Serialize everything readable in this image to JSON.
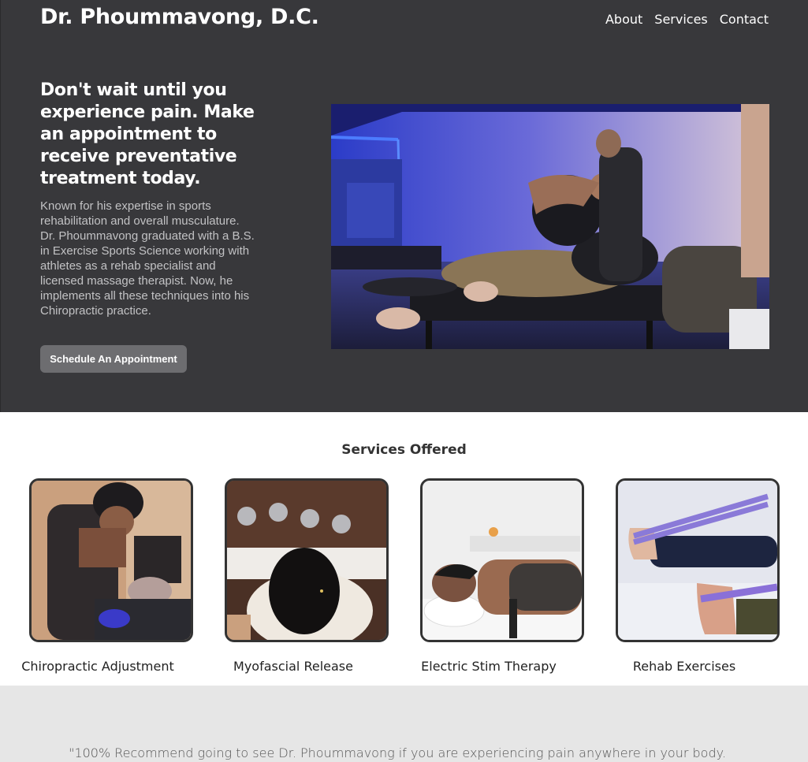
{
  "header": {
    "brand": "Dr. Phoummavong, D.C.",
    "nav": [
      "About",
      "Services",
      "Contact"
    ]
  },
  "hero": {
    "headline": "Don't wait until you experience pain. Make an appointment to receive preventative treatment today.",
    "bio": "Known for his expertise in sports rehabilitation and overall musculature. Dr. Phoummavong graduated with a B.S. in Exercise Sports Science working with athletes as a rehab specialist and licensed massage therapist. Now, he implements all these techniques into his Chiropractic practice.",
    "cta_label": "Schedule An Appointment"
  },
  "services": {
    "title": "Services Offered",
    "items": [
      {
        "label": "Chiropractic Adjustment"
      },
      {
        "label": "Myofascial Release"
      },
      {
        "label": "Electric Stim Therapy"
      },
      {
        "label": "Rehab Exercises"
      }
    ]
  },
  "testimonial": {
    "quote": "\"100% Recommend going to see Dr. Phoummavong if you are experiencing pain anywhere in your body."
  },
  "colors": {
    "hero_bg": "#38383b",
    "button_bg": "#6d6d70",
    "testimonial_bg": "#e6e6e6"
  }
}
